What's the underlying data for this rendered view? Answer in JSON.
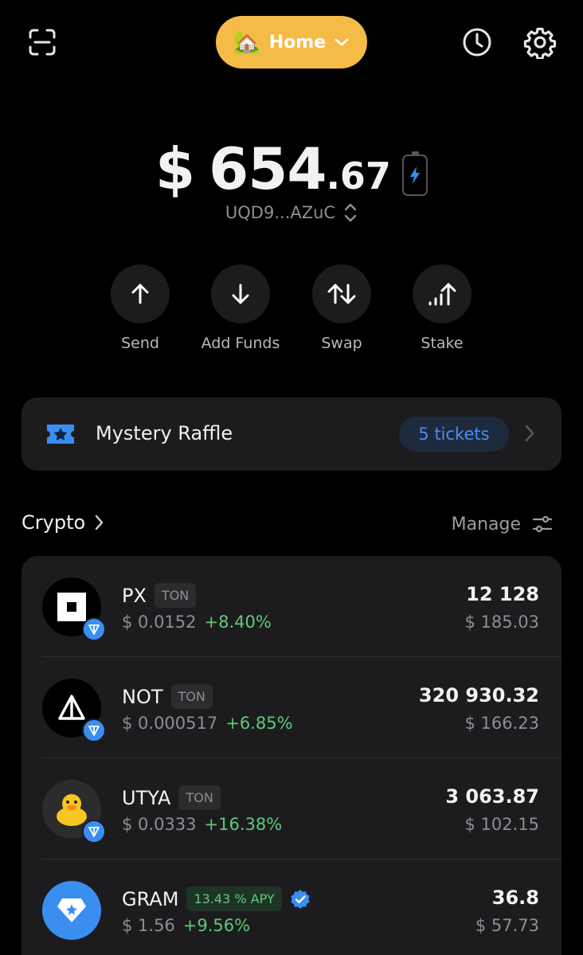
{
  "header": {
    "wallet_name": "Home",
    "wallet_emoji": "🏡"
  },
  "balance": {
    "currency": "$",
    "main": "654",
    "cents": ".67"
  },
  "address": "UQD9...AZuC",
  "actions": [
    {
      "label": "Send",
      "icon": "arrow-up-icon"
    },
    {
      "label": "Add Funds",
      "icon": "arrow-down-icon"
    },
    {
      "label": "Swap",
      "icon": "swap-icon"
    },
    {
      "label": "Stake",
      "icon": "stake-icon"
    }
  ],
  "raffle": {
    "title": "Mystery Raffle",
    "badge": "5 tickets"
  },
  "crypto": {
    "title": "Crypto",
    "manage_label": "Manage"
  },
  "assets": [
    {
      "name": "PX",
      "tag": "TON",
      "price": "$ 0.0152",
      "change": "+8.40%",
      "amount": "12 128",
      "value": "$ 185.03"
    },
    {
      "name": "NOT",
      "tag": "TON",
      "price": "$ 0.000517",
      "change": "+6.85%",
      "amount": "320 930.32",
      "value": "$ 166.23"
    },
    {
      "name": "UTYA",
      "tag": "TON",
      "price": "$ 0.0333",
      "change": "+16.38%",
      "amount": "3 063.87",
      "value": "$ 102.15"
    },
    {
      "name": "GRAM",
      "tag": "13.43 % APY",
      "price": "$ 1.56",
      "change": "+9.56%",
      "amount": "36.8",
      "value": "$ 57.73"
    }
  ],
  "colors": {
    "accent_yellow": "#f5bb47",
    "accent_blue": "#3a8ef0",
    "positive_green": "#5fc97a",
    "background": "#000000",
    "card": "#1c1c1e"
  }
}
